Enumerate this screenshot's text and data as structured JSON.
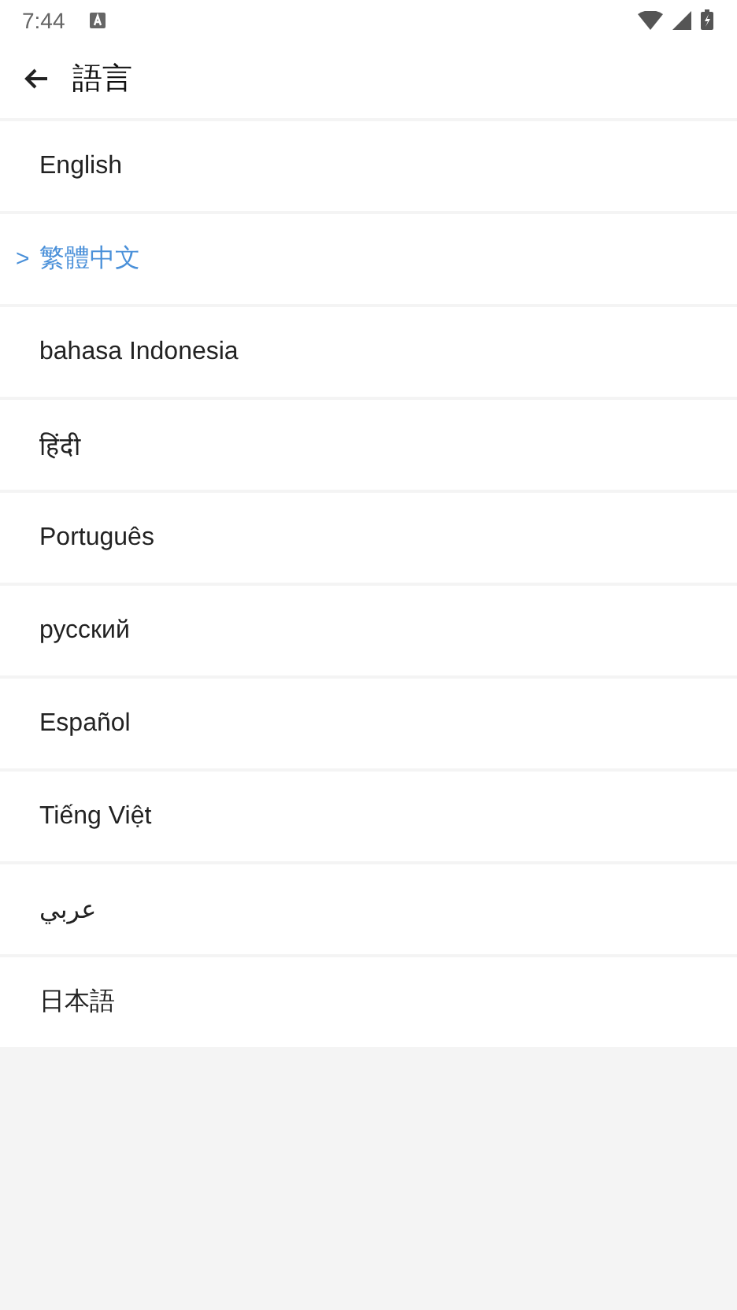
{
  "status_bar": {
    "time": "7:44"
  },
  "toolbar": {
    "title": "語言"
  },
  "languages": {
    "selected_marker": ">",
    "items": [
      {
        "label": "English",
        "selected": false
      },
      {
        "label": "繁體中文",
        "selected": true
      },
      {
        "label": "bahasa Indonesia",
        "selected": false
      },
      {
        "label": "हिंदी",
        "selected": false
      },
      {
        "label": "Português",
        "selected": false
      },
      {
        "label": "русский",
        "selected": false
      },
      {
        "label": "Español",
        "selected": false
      },
      {
        "label": "Tiếng Việt",
        "selected": false
      },
      {
        "label": "عربي",
        "selected": false
      },
      {
        "label": "日本語",
        "selected": false
      }
    ]
  }
}
